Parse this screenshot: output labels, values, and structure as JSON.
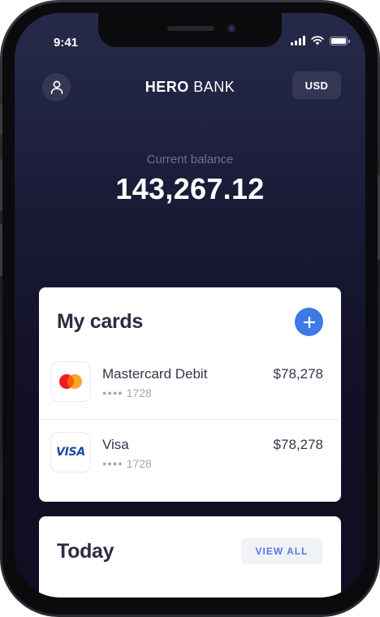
{
  "status_bar": {
    "time": "9:41"
  },
  "header": {
    "brand_bold": "HERO",
    "brand_light": "BANK",
    "currency": "USD"
  },
  "balance": {
    "label": "Current balance",
    "value": "143,267.12"
  },
  "cards_panel": {
    "title": "My cards",
    "cards": [
      {
        "name": "Mastercard Debit",
        "mask_dots": "●●●●",
        "last4": "1728",
        "amount": "$78,278",
        "logo": "mastercard-logo"
      },
      {
        "name": "Visa",
        "mask_dots": "●●●●",
        "last4": "1728",
        "amount": "$78,278",
        "logo": "visa-logo",
        "logo_text": "VISA"
      }
    ]
  },
  "today_panel": {
    "title": "Today",
    "view_all_label": "VIEW ALL"
  },
  "colors": {
    "accent": "#3d7ae5",
    "background_top": "#262a4a",
    "background_bottom": "#0f0e22",
    "mastercard_red": "#eb1c24",
    "mastercard_orange": "#f79e1b",
    "visa_blue": "#1a4a9b"
  }
}
